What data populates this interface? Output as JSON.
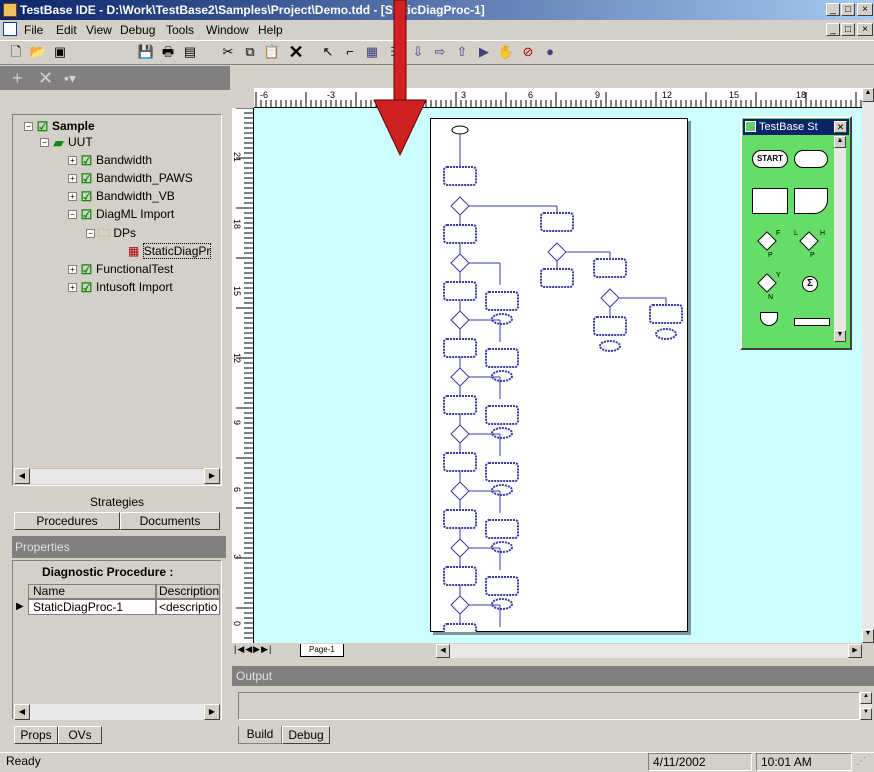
{
  "window": {
    "title": "TestBase IDE - D:\\Work\\TestBase2\\Samples\\Project\\Demo.tdd - [StaticDiagProc-1]",
    "minimize": "_",
    "restore": "□",
    "close": "×"
  },
  "menu": [
    "File",
    "Edit",
    "View",
    "Debug",
    "Tools",
    "Window",
    "Help"
  ],
  "tree": {
    "root": "Sample",
    "uut": "UUT",
    "items": [
      "Bandwidth",
      "Bandwidth_PAWS",
      "Bandwidth_VB",
      "DiagML Import"
    ],
    "folder": "DPs",
    "leaf": "StaticDiagPr",
    "items2": [
      "FunctionalTest",
      "Intusoft Import"
    ]
  },
  "left_tabs": {
    "strategies": "Strategies",
    "procedures": "Procedures",
    "documents": "Documents"
  },
  "properties": {
    "header": "Properties",
    "section": "Diagnostic Procedure :",
    "col_name": "Name",
    "col_desc": "Description",
    "row_name": "StaticDiagProc-1",
    "row_desc": "<descriptio"
  },
  "bottom_tabs": {
    "props": "Props",
    "ovs": "OVs"
  },
  "ruler": {
    "h": [
      "-6",
      "-3",
      "0",
      "3",
      "6",
      "9",
      "12",
      "15",
      "18"
    ],
    "v": [
      "21",
      "18",
      "15",
      "12",
      "9",
      "6",
      "3",
      "0"
    ]
  },
  "page_tab": "Page-1",
  "palette": {
    "title": "TestBase St",
    "start": "START",
    "labels": [
      "F",
      "L",
      "H",
      "P",
      "P",
      "Y",
      "N"
    ]
  },
  "output": {
    "header": "Output",
    "build": "Build",
    "debug": "Debug"
  },
  "status": {
    "text": "Ready",
    "date": "4/11/2002",
    "time": "10:01 AM"
  }
}
